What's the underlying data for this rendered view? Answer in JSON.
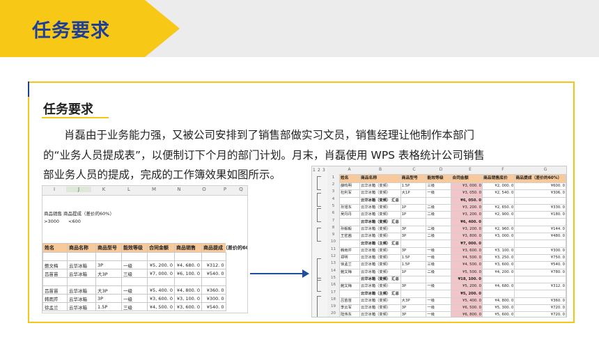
{
  "header": {
    "title": "任务要求"
  },
  "section": {
    "title": "任务要求",
    "paragraph_lines": [
      "肖磊由于业务能力强，又被公司安排到了销售部做实习文员，销售经理让他制作本部门",
      "的“业务人员提成表”，以便制订下个月的部门计划。月末，肖磊使用 WPS 表格统计公司销售",
      "部业务人员的提成，完成的工作簿效果如图所示。"
    ]
  },
  "left_sheet": {
    "columns": [
      "I",
      "J",
      "K",
      "L",
      "M",
      "N",
      "O",
      "P",
      "Q"
    ],
    "selected_column": "J",
    "notes": [
      "商品销售",
      "商品提成（差价的60%）",
      ">3000",
      "<600"
    ],
    "headers": [
      "姓名",
      "商品名称",
      "商品型号",
      "能效等级",
      "合同金额",
      "商品销售",
      "商品提成（差价的60%）"
    ],
    "rows": [
      [
        "",
        "",
        "",
        "",
        "",
        "",
        ""
      ],
      [
        "鲍文梅",
        "云华冰箱",
        "3P",
        "一级",
        "¥5, 200. 0",
        "¥4, 680. 0",
        "¥312. 0"
      ],
      [
        "吕苗苗",
        "云华冰箱",
        "大3P",
        "三级",
        "¥7, 000. 0",
        "¥6, 100. 0",
        "¥540. 0"
      ],
      [
        "",
        "",
        "",
        "",
        "",
        "",
        ""
      ],
      [
        "吕苗苗",
        "云华冰箱",
        "大3P",
        "一级",
        "¥5, 400. 0",
        "¥4, 800. 0",
        "¥360. 0"
      ],
      [
        "韩雨芹",
        "云华冰箱",
        "3P",
        "一级",
        "¥3, 600. 0",
        "¥3, 100. 0",
        "¥300. 0"
      ],
      [
        "徐孟兰",
        "云华冰箱",
        "1.5P",
        "三级",
        "¥4, 500. 0",
        "¥3, 600. 0",
        "¥540. 0"
      ]
    ]
  },
  "right_sheet": {
    "columns": [
      "A",
      "B",
      "C",
      "D",
      "E",
      "F",
      "G"
    ],
    "outline_levels": [
      "1",
      "2",
      "3"
    ],
    "headers": [
      "姓名",
      "商品名称",
      "商品型号",
      "能效等级",
      "合同金额",
      "商品销售底价",
      "商品提成（差价的60%）"
    ],
    "rows": [
      {
        "n": "2",
        "cells": [
          "薛鸣明",
          "云华冰箱（变频）",
          "1.5P",
          "三级",
          "¥3, 000. 0",
          "¥2, 000. 0",
          "¥600. 0"
        ],
        "sum": false
      },
      {
        "n": "3",
        "cells": [
          "杜利军",
          "云华冰箱（变频）",
          "大1P",
          "一级",
          "¥3, 050. 0",
          "¥2, 540. 0",
          "¥306. 0"
        ],
        "sum": false
      },
      {
        "n": "4",
        "cells": [
          "",
          "云华冰箱（变频） 汇总",
          "",
          "",
          "¥6, 050. 0",
          "",
          ""
        ],
        "sum": true
      },
      {
        "n": "5",
        "cells": [
          "孙旭东",
          "云华冰箱（变频）",
          "1P",
          "二级",
          "¥3, 200. 0",
          "¥2, 650. 0",
          "¥330. 0"
        ],
        "sum": false
      },
      {
        "n": "6",
        "cells": [
          "吴丹丹",
          "云华冰箱（变频）",
          "1P",
          "二级",
          "¥3, 200. 0",
          "¥2, 900. 0",
          "¥180. 0"
        ],
        "sum": false
      },
      {
        "n": "7",
        "cells": [
          "",
          "云华冰箱（变频） 汇总",
          "",
          "",
          "¥6, 400. 0",
          "",
          ""
        ],
        "sum": true
      },
      {
        "n": "8",
        "cells": [
          "孙毅毅",
          "云华冰箱（变频）",
          "3P",
          "二级",
          "¥3, 200. 0",
          "¥2, 960. 0",
          "¥144. 0"
        ],
        "sum": false
      },
      {
        "n": "9",
        "cells": [
          "王密茜",
          "云华冰箱（变频）",
          "3P",
          "二级",
          "¥3, 800. 0",
          "¥3, 000. 0",
          "¥480. 0"
        ],
        "sum": false
      },
      {
        "n": "10",
        "cells": [
          "",
          "云华冰箱（主频） 汇总",
          "",
          "",
          "¥7, 000. 0",
          "",
          ""
        ],
        "sum": true
      },
      {
        "n": "11",
        "cells": [
          "韩雨芹",
          "云华冰箱（变频）",
          "3P",
          "一级",
          "¥3, 600. 0",
          "¥3, 100. 0",
          "¥300. 0"
        ],
        "sum": false
      },
      {
        "n": "12",
        "cells": [
          "郑明",
          "云华冰箱（变频）",
          "1.5P",
          "一级",
          "¥4, 500. 0",
          "¥3, 250. 0",
          "¥750. 0"
        ],
        "sum": false
      },
      {
        "n": "13",
        "cells": [
          "徐孟兰",
          "云华冰箱（变频）",
          "1.5P",
          "三级",
          "¥4, 500. 0",
          "¥3, 600. 0",
          "¥540. 0"
        ],
        "sum": false
      },
      {
        "n": "14",
        "cells": [
          "鲍文梅",
          "云华冰箱（变频）",
          "1P",
          "二级",
          "¥5, 500. 0",
          "¥4, 200. 0",
          "¥780. 0"
        ],
        "sum": false
      },
      {
        "n": "15",
        "cells": [
          "",
          "云华冰箱（变频） 汇总",
          "",
          "",
          "¥18, 100. 0",
          "",
          ""
        ],
        "sum": true
      },
      {
        "n": "16",
        "cells": [
          "鲍文梅",
          "云华冰箱（变频）",
          "3P",
          "一级",
          "¥5, 200. 0",
          "¥4, 680. 0",
          "¥312. 0"
        ],
        "sum": false
      },
      {
        "n": "17",
        "cells": [
          "",
          "云华冰箱（主频） 汇总",
          "",
          "",
          "¥5, 200. 0",
          "",
          ""
        ],
        "sum": true
      },
      {
        "n": "18",
        "cells": [
          "吕苗苗",
          "云华冰箱（变频）",
          "大3P",
          "一级",
          "¥5, 400. 0",
          "¥4, 800. 0",
          "¥360. 0"
        ],
        "sum": false
      },
      {
        "n": "19",
        "cells": [
          "李云军",
          "云华冰箱（变频）",
          "3P",
          "一级",
          "¥6, 500. 0",
          "¥5, 300. 0",
          "¥720. 0"
        ],
        "sum": false
      },
      {
        "n": "20",
        "cells": [
          "陆伟东",
          "云华冰箱（变频）",
          "3P",
          "一级",
          "¥6, 800. 0",
          "¥5, 600. 0",
          "¥720. 0"
        ],
        "sum": false
      }
    ]
  },
  "colors": {
    "accent_yellow": "#f7c815",
    "title_blue": "#1d3f97",
    "header_fill": "#f7c99b",
    "highlight_pink": "#f2c6c8",
    "arrow_blue": "#1f4e9c"
  }
}
